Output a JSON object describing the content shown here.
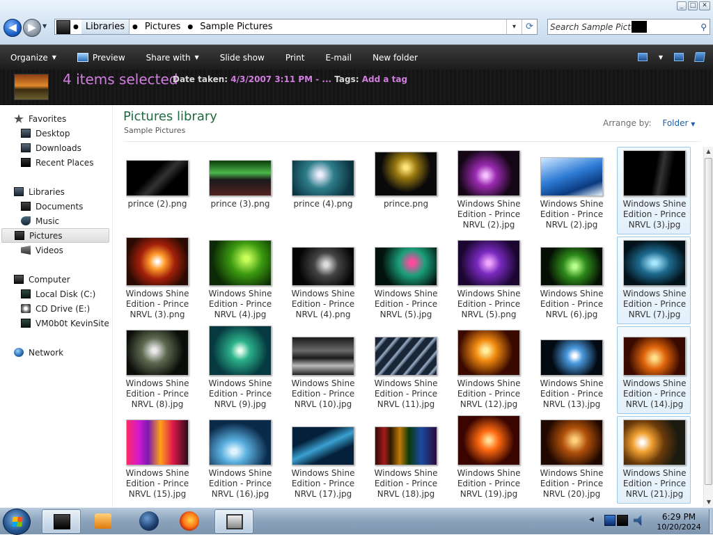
{
  "window": {
    "caption_buttons": [
      "_",
      "□",
      "✕"
    ]
  },
  "address": {
    "crumbs": [
      "Libraries",
      "Pictures",
      "Sample Pictures"
    ],
    "dropdown_arrow": "▾",
    "refresh_glyph": "⟳"
  },
  "search": {
    "placeholder": "Search Sample Pictures",
    "value": "Search Sample Pictures"
  },
  "toolbar": {
    "organize": "Organize",
    "preview": "Preview",
    "share_with": "Share with",
    "slide_show": "Slide show",
    "print": "Print",
    "email": "E-mail",
    "new_folder": "New folder",
    "dropdown_glyph": "▼"
  },
  "details": {
    "count": "4 items selected",
    "date_label": "Date taken:",
    "date_value": "4/3/2007 3:11 PM - ...",
    "tags_label": "Tags:",
    "tags_value": "Add a tag"
  },
  "navpane": {
    "favorites": "Favorites",
    "desktop": "Desktop",
    "downloads": "Downloads",
    "recent": "Recent Places",
    "libraries": "Libraries",
    "documents": "Documents",
    "music": "Music",
    "pictures": "Pictures",
    "videos": "Videos",
    "computer": "Computer",
    "local_disk": "Local Disk (C:)",
    "cd_drive": "CD Drive (E:)",
    "vm": "VM0b0t KevinSite",
    "network": "Network"
  },
  "content": {
    "title": "Pictures library",
    "subtitle": "Sample Pictures",
    "arrange_label": "Arrange by:",
    "arrange_value": "Folder",
    "arrange_arrow": "▼"
  },
  "files": [
    {
      "name": "prince (2).png",
      "bg": "linear-gradient(135deg,#000 40%,#333 55%,#000 70%)",
      "w": 90,
      "h": 52,
      "selected": false
    },
    {
      "name": "prince (3).png",
      "bg": "linear-gradient(#0b3d0b,#4bb84b 35%,#1a1a1a 55%,#552222)",
      "w": 90,
      "h": 52,
      "selected": false
    },
    {
      "name": "prince (4).png",
      "bg": "radial-gradient(circle at 45% 40%,#eef 5%,#2e7d8a 35%,#0b3340 80%)",
      "w": 90,
      "h": 52,
      "selected": false
    },
    {
      "name": "prince.png",
      "bg": "radial-gradient(circle at 50% 35%,#ffe27a 5%,#9a7a10 25%,#0a0a0a 60%)",
      "w": 90,
      "h": 64,
      "selected": false
    },
    {
      "name": "Windows Shine Edition - Prince NRVL (2).jpg",
      "bg": "radial-gradient(circle at 45% 55%,#f6c2ff 4%,#9a2ab0 25%,#140615 65%)",
      "w": 90,
      "h": 66,
      "selected": false
    },
    {
      "name": "Windows Shine Edition - Prince NRVL (2).jpg",
      "bg": "linear-gradient(160deg,#cfe8ff,#2e7cd6 45%,#0a3a80 75%,#e8f3ff)",
      "w": 90,
      "h": 56,
      "selected": false
    },
    {
      "name": "Windows Shine Edition - Prince NRVL (3).jpg",
      "bg": "linear-gradient(100deg,#000 50%,#333 60%,#000 75%)",
      "w": 90,
      "h": 66,
      "selected": true
    },
    {
      "name": "Windows Shine Edition - Prince NRVL (3).png",
      "bg": "radial-gradient(circle at 50% 50%,#fff 3%,#ff9a2a 20%,#a3200a 45%,#2a0a02 80%)",
      "w": 90,
      "h": 70,
      "selected": false
    },
    {
      "name": "Windows Shine Edition - Prince NRVL (4).jpg",
      "bg": "radial-gradient(circle at 60% 40%,#c9ff5a 5%,#3b9a10 35%,#0b2a05 75%)",
      "w": 90,
      "h": 66,
      "selected": false
    },
    {
      "name": "Windows Shine Edition - Prince NRVL (4).png",
      "bg": "radial-gradient(circle at 55% 45%,#ddd 5%,#444 30%,#050505 70%)",
      "w": 90,
      "h": 56,
      "selected": false
    },
    {
      "name": "Windows Shine Edition - Prince NRVL (5).jpg",
      "bg": "radial-gradient(circle at 60% 40%,#ff4aa0 5%,#1aa07a 30%,#02120c 70%)",
      "w": 90,
      "h": 56,
      "selected": false
    },
    {
      "name": "Windows Shine Edition - Prince NRVL (5).png",
      "bg": "radial-gradient(circle at 50% 50%,#f1a6ff 5%,#7a2ac0 30%,#1a0630 75%)",
      "w": 90,
      "h": 66,
      "selected": false
    },
    {
      "name": "Windows Shine Edition - Prince NRVL (6).jpg",
      "bg": "radial-gradient(circle at 55% 50%,#b6ff8a 5%,#2d8a1a 30%,#050f04 70%)",
      "w": 90,
      "h": 56,
      "selected": false
    },
    {
      "name": "Windows Shine Edition - Prince NRVL (7).jpg",
      "bg": "radial-gradient(ellipse at 50% 50%,#a6e7ff 5%,#1d6a8e 35%,#02121a 75%)",
      "w": 90,
      "h": 66,
      "selected": true
    },
    {
      "name": "Windows Shine Edition - Prince NRVL (8).jpg",
      "bg": "radial-gradient(circle at 45% 45%,#eaeaea 5%,#5d6a50 30%,#0b0d09 70%)",
      "w": 90,
      "h": 66,
      "selected": false
    },
    {
      "name": "Windows Shine Edition - Prince NRVL (9).jpg",
      "bg": "radial-gradient(circle at 50% 50%,#eafff0 4%,#2bb08a 25%,#063a40 70%)",
      "w": 90,
      "h": 72,
      "selected": false
    },
    {
      "name": "Windows Shine Edition - Prince NRVL (10).jpg",
      "bg": "linear-gradient(#1a1a1a,#6a6a6a 35%,#1a1a1a 55%,#bbb 75%,#222)",
      "w": 90,
      "h": 56,
      "selected": false
    },
    {
      "name": "Windows Shine Edition - Prince NRVL (11).jpg",
      "bg": "repeating-linear-gradient(130deg,#1a2636 0 8px,#9fb0c8 10px,#3a4a60 14px)",
      "w": 90,
      "h": 56,
      "selected": false
    },
    {
      "name": "Windows Shine Edition - Prince NRVL (12).jpg",
      "bg": "radial-gradient(circle at 45% 45%,#fff0a0 5%,#f28a10 25%,#3a0a00 65%)",
      "w": 90,
      "h": 66,
      "selected": false
    },
    {
      "name": "Windows Shine Edition - Prince NRVL (13).jpg",
      "bg": "radial-gradient(circle at 55% 45%,#fff 4%,#4a9adf 20%,#020a14 60%)",
      "w": 90,
      "h": 52,
      "selected": false
    },
    {
      "name": "Windows Shine Edition - Prince NRVL (14).jpg",
      "bg": "radial-gradient(circle at 50% 55%,#ffe08a 5%,#e0640a 30%,#3a0a00 70%)",
      "w": 90,
      "h": 56,
      "selected": true
    },
    {
      "name": "Windows Shine Edition - Prince NRVL (15).jpg",
      "bg": "linear-gradient(90deg,#ff2a6a,#d01ad0 20%,#7a1ab0 35%,#ffa01a 55%,#e01a4a 75%,#2a0a1a)",
      "w": 90,
      "h": 66,
      "selected": false
    },
    {
      "name": "Windows Shine Edition - Prince NRVL (16).jpg",
      "bg": "radial-gradient(ellipse at 40% 70%,#dff3ff 5%,#5ab0e0 25%,#0a2a4a 65%)",
      "w": 90,
      "h": 66,
      "selected": false
    },
    {
      "name": "Windows Shine Edition - Prince NRVL (17).jpg",
      "bg": "linear-gradient(155deg,#04203a 30%,#3aa0d0 50%,#04203a 70%)",
      "w": 90,
      "h": 56,
      "selected": false
    },
    {
      "name": "Windows Shine Edition - Prince NRVL (18).jpg",
      "bg": "linear-gradient(90deg,#3a0a0a,#a01a1a 15%,#2a1a00 25%,#c07a0a 40%,#0a3a0a 55%,#1a4aa0 75%,#2a0a3a)",
      "w": 90,
      "h": 56,
      "selected": false
    },
    {
      "name": "Windows Shine Edition - Prince NRVL (19).jpg",
      "bg": "radial-gradient(circle at 50% 50%,#ffe09a 4%,#ff6a10 25%,#3a0500 65%)",
      "w": 90,
      "h": 72,
      "selected": false
    },
    {
      "name": "Windows Shine Edition - Prince NRVL (20).jpg",
      "bg": "radial-gradient(circle at 55% 45%,#ffd07a 5%,#b0500a 30%,#200800 70%)",
      "w": 90,
      "h": 66,
      "selected": false
    },
    {
      "name": "Windows Shine Edition - Prince NRVL (21).jpg",
      "bg": "radial-gradient(circle at 30% 50%,#fff 3%,#f0a030 20%,#6a3a0a 45%,#1a1a10 75%)",
      "w": 90,
      "h": 66,
      "selected": true
    }
  ],
  "taskbar": {
    "tray_arrow": "◀",
    "time": "6:29 PM",
    "date": "10/20/2024"
  }
}
